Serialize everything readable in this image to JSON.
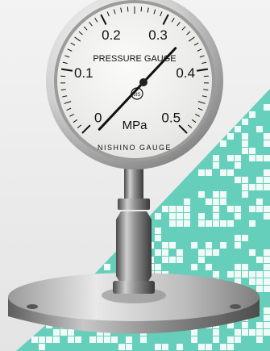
{
  "photo": {
    "subject": "pressure-gauge-with-diaphragm-seal",
    "gauge": {
      "brand_line": "PRESSURE GAUGE",
      "maker": "NISHINO GAUGE",
      "unit": "MPa",
      "scale_labels": [
        "0",
        "0.1",
        "0.2",
        "0.3",
        "0.4",
        "0.5"
      ],
      "scale_min": 0,
      "scale_max": 0.5,
      "needle_reading": 0.33,
      "logo_text": "JIS"
    },
    "colors": {
      "background": "#ececec",
      "accent_pattern": "#5fcdb8",
      "dial_face": "#f4f4f2",
      "metal_light": "#e9e9e9",
      "metal_dark": "#6f6f6f",
      "needle": "#111111"
    }
  }
}
